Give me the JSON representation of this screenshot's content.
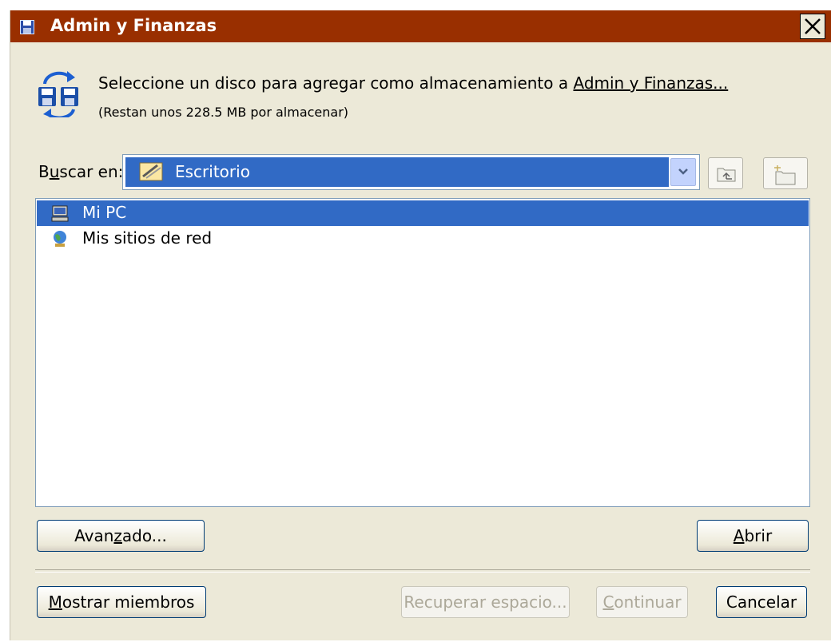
{
  "window": {
    "title": "Admin y Finanzas",
    "close_label": "Close"
  },
  "header": {
    "message_prefix": "Seleccione un disco para agregar como almacenamiento a ",
    "message_link": "Admin y Finanzas...",
    "submessage": "(Restan unos 228.5 MB por almacenar)"
  },
  "look_in": {
    "label_pre": "B",
    "label_ul": "u",
    "label_post": "scar en:",
    "value": "Escritorio",
    "icon": "desktop-icon"
  },
  "toolbar": {
    "up_icon": "up-folder-icon",
    "new_folder_icon": "new-folder-icon"
  },
  "files": [
    {
      "label": "Mi PC",
      "icon": "computer-icon",
      "selected": true
    },
    {
      "label": "Mis sitios de red",
      "icon": "network-places-icon",
      "selected": false
    }
  ],
  "buttons": {
    "advanced_pre": "Avan",
    "advanced_ul": "z",
    "advanced_post": "ado...",
    "open_ul": "A",
    "open_post": "brir",
    "show_members_ul": "M",
    "show_members_post": "ostrar miembros",
    "recover": "Recuperar espacio...",
    "continue_ul": "C",
    "continue_post": "ontinuar",
    "cancel": "Cancelar"
  },
  "colors": {
    "titlebar": "#992f00",
    "selection": "#316ac5",
    "dialog_bg": "#ece9d8"
  }
}
